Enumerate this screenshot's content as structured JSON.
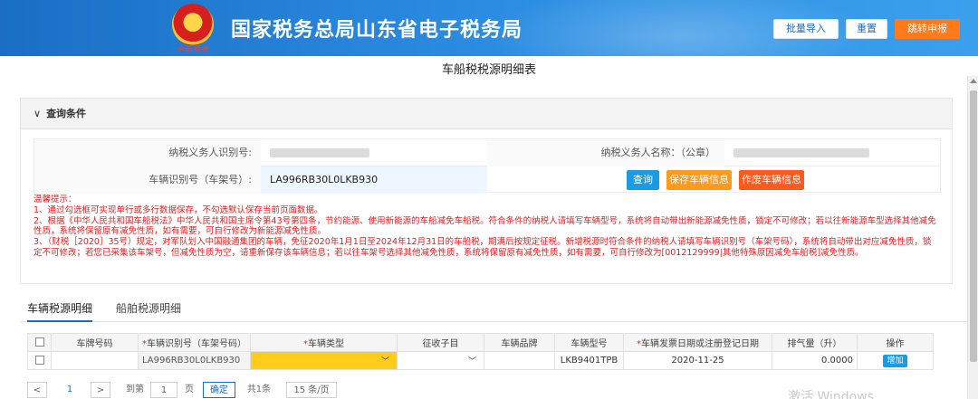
{
  "header": {
    "site_title": "国家税务总局山东省电子税务局",
    "emblem_caption": "中国税务",
    "buttons": {
      "batch_import": "批量导入",
      "reset": "重置",
      "redirect": "跳转申报"
    }
  },
  "page_title": "车船税税源明细表",
  "query": {
    "section_title": "查询条件",
    "taxpayer_id_label": "纳税义务人识别号:",
    "taxpayer_name_label": "纳税义务人名称：（公章）",
    "vin_label": "车辆识别号（车架号）:",
    "vin_value": "LA996RB30L0LKB930",
    "buttons": {
      "query": "查询",
      "save": "保存车辆信息",
      "void": "作废车辆信息"
    },
    "colors": {
      "query": "#1a9be6",
      "save": "#ff9a1e",
      "void": "#ff5a1e"
    }
  },
  "tips": {
    "title": "温馨提示：",
    "lines": [
      "1、通过勾选框可实现单行或多行数据保存，不勾选默认保存当前页面数据。",
      "2、根据《中华人民共和国车船税法》中华人民共和国主席令第43号第四条，节约能源、使用新能源的车船减免车船税。符合条件的纳税人请填写车辆型号，系统将自动带出新能源减免性质，锁定不可修改；若以往新能源车型选择其他减免性质，系统将保留原有减免性质，如有需要，可自行修改为新能源减免性质。",
      "3、（财税［2020］35号）规定，对军队划入中国融通集团的车辆，免征2020年1月1日至2024年12月31日的车船税，期满后按规定征税。新增税源时符合条件的纳税人请填写车辆识别号（车架号码），系统将自动带出对应减免性质，锁定不可修改；若您已采集该车架号，但减免性质为空，请重新保存该车辆信息；若以往车架号选择其他减免性质，系统将保留原有减免性质，如有需要，可自行修改为[0012129999|其他特殊原因减免车船税]减免性质。"
    ]
  },
  "tabs": [
    "车辆税源明细",
    "船舶税源明细"
  ],
  "table": {
    "headers": [
      "车牌号码",
      "车辆识别号（车架号码）",
      "车辆类型",
      "征收子目",
      "车辆品牌",
      "车辆型号",
      "车辆发票日期或注册登记日期",
      "排气量（升）",
      "操作"
    ],
    "required": [
      false,
      true,
      true,
      false,
      false,
      false,
      true,
      false,
      false
    ],
    "row": {
      "plate": "",
      "vin": "LA996RB30L0LKB930",
      "vehicle_type": "",
      "sub_item": "",
      "brand": "",
      "model": "LKB9401TPB",
      "date": "2020-11-25",
      "displacement": "0.0000",
      "action": "增加"
    }
  },
  "pager": {
    "prev": "<",
    "page": "1",
    "next": ">",
    "goto_label": "到第",
    "goto_value": "1",
    "page_unit": "页",
    "confirm": "确定",
    "total": "共1条",
    "page_size": "15 条/页"
  },
  "watermark": "激活 Windows"
}
